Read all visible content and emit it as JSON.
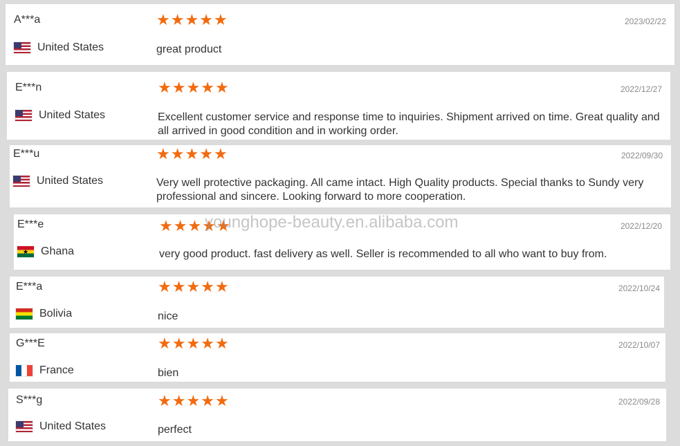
{
  "watermark": "younghope-beauty.en.alibaba.com",
  "star_color": "#f26b0f",
  "reviews": [
    {
      "name": "A***a",
      "country": "United States",
      "flag": "us-flag-icon",
      "rating": 5,
      "date": "2023/02/22",
      "comment": "great product"
    },
    {
      "name": "E***n",
      "country": "United States",
      "flag": "us-flag-icon",
      "rating": 5,
      "date": "2022/12/27",
      "comment": "Excellent customer service and response time to inquiries. Shipment arrived on time. Great quality and all arrived in good condition and in working order."
    },
    {
      "name": "E***u",
      "country": "United States",
      "flag": "us-flag-icon",
      "rating": 5,
      "date": "2022/09/30",
      "comment": "Very well protective packaging. All came intact. High Quality products. Special thanks to Sundy very professional and sincere. Looking forward to more cooperation."
    },
    {
      "name": "E***e",
      "country": "Ghana",
      "flag": "ghana-flag-icon",
      "rating": 5,
      "date": "2022/12/20",
      "comment": "very good product. fast delivery as well. Seller is recommended to all who want to buy from."
    },
    {
      "name": "E***a",
      "country": "Bolivia",
      "flag": "bolivia-flag-icon",
      "rating": 5,
      "date": "2022/10/24",
      "comment": "nice"
    },
    {
      "name": "G***E",
      "country": "France",
      "flag": "france-flag-icon",
      "rating": 5,
      "date": "2022/10/07",
      "comment": "bien"
    },
    {
      "name": "S***g",
      "country": "United States",
      "flag": "us-flag-icon",
      "rating": 5,
      "date": "2022/09/28",
      "comment": "perfect"
    }
  ]
}
